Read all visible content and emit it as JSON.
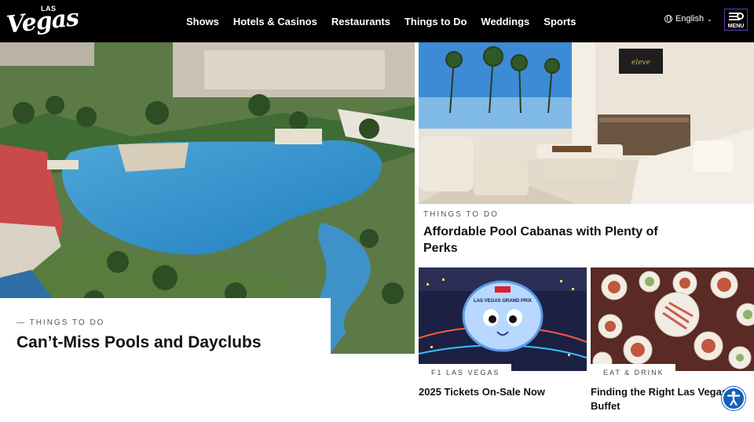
{
  "header": {
    "logo": {
      "top": "LAS",
      "main": "Vegas"
    },
    "nav": [
      "Shows",
      "Hotels & Casinos",
      "Restaurants",
      "Things to Do",
      "Weddings",
      "Sports"
    ],
    "language": "English",
    "menu_label": "MENU"
  },
  "hero": {
    "kicker": "— THINGS TO DO",
    "title": "Can’t-Miss Pools and Dayclubs"
  },
  "feature": {
    "kicker": "THINGS TO DO",
    "title": "Affordable Pool Cabanas with Plenty of Perks",
    "sign_text": "eleve"
  },
  "cards": [
    {
      "kicker": "F1 LAS VEGAS",
      "title": "2025 Tickets On-Sale Now",
      "image_text": "LAS VEGAS GRAND PRIX"
    },
    {
      "kicker": "EAT & DRINK",
      "title": "Finding the Right Las Vegas Buffet"
    }
  ],
  "icons": {
    "globe": "globe-icon",
    "menu": "menu-search-icon",
    "accessibility": "accessibility-icon"
  },
  "colors": {
    "header_bg": "#000000",
    "menu_border": "#6a3bb0",
    "accessibility": "#1561b8"
  }
}
